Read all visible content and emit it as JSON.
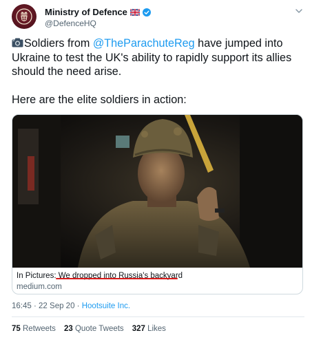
{
  "tweet": {
    "account": {
      "display_name": "Ministry of Defence",
      "handle": "@DefenceHQ",
      "avatar_icon": "royal-crest-icon",
      "flag_icon": "union-jack-flag-icon",
      "verified_icon": "verified-badge-icon"
    },
    "text": {
      "line1_icon": "camera-icon",
      "line1_before": "Soldiers from ",
      "mention": "@TheParachuteReg",
      "line1_after": " have jumped into Ukraine to test the UK's ability to rapidly support its allies should the need arise.",
      "line2": "Here are the elite soldiers in action:"
    },
    "card": {
      "title": "In Pictures: We dropped into Russia's backyard",
      "domain": "medium.com"
    },
    "meta": {
      "time": "16:45",
      "date": "22 Sep 20",
      "separator": "·",
      "source": "Hootsuite Inc."
    },
    "stats": {
      "retweets_count": "75",
      "retweets_label": "Retweets",
      "quotes_count": "23",
      "quotes_label": "Quote Tweets",
      "likes_count": "327",
      "likes_label": "Likes"
    },
    "colors": {
      "link": "#1d9bf0",
      "secondary_text": "#536471",
      "underline_annotation": "#d91a1a"
    }
  }
}
